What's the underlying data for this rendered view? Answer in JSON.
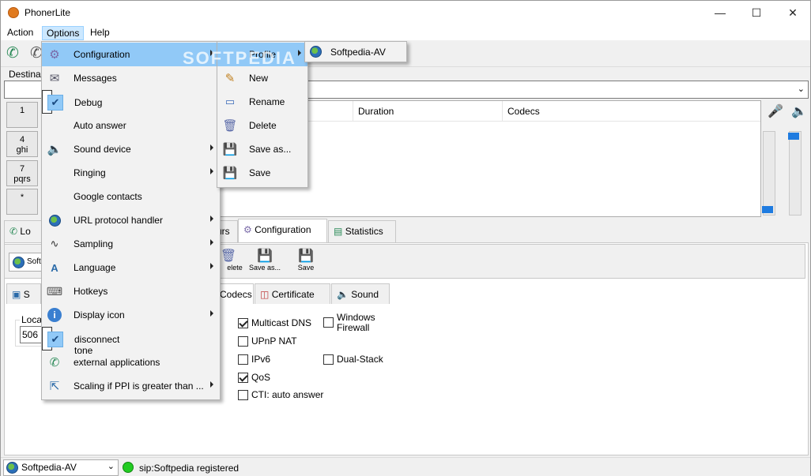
{
  "window": {
    "title": "PhonerLite"
  },
  "menubar": {
    "items": [
      "Action",
      "Options",
      "Help"
    ]
  },
  "destination": {
    "label": "Destina",
    "value": ""
  },
  "keypad": [
    {
      "main": "1",
      "sub": ""
    },
    {
      "main": "4",
      "sub": "ghi"
    },
    {
      "main": "7",
      "sub": "pqrs"
    },
    {
      "main": "*",
      "sub": ""
    }
  ],
  "call_list": {
    "columns": [
      "Duration",
      "Codecs"
    ]
  },
  "tabs_main": {
    "partial_left": "Lo",
    "partial_mid": "urs",
    "configuration": "Configuration",
    "statistics": "Statistics"
  },
  "profile_bar": {
    "profile_partial": "Soft",
    "buttons": [
      "elete",
      "Save as...",
      "Save"
    ]
  },
  "tabs_sub": {
    "partial": "S",
    "codecs": "Codecs",
    "certificate": "Certificate",
    "sound": "Sound"
  },
  "local": {
    "label": "Loca",
    "value": "506"
  },
  "options": [
    {
      "label": "Multicast DNS",
      "checked": true
    },
    {
      "label": "UPnP NAT",
      "checked": false
    },
    {
      "label": "IPv6",
      "checked": false
    },
    {
      "label": "QoS",
      "checked": true
    },
    {
      "label": "CTI: auto answer",
      "checked": false
    },
    {
      "label": "Windows Firewall",
      "checked": false
    },
    {
      "label": "Dual-Stack",
      "checked": false
    }
  ],
  "status": {
    "profile": "Softpedia-AV",
    "text": "sip:Softpedia registered",
    "led_color": "#22cc22"
  },
  "options_menu": [
    {
      "label": "Configuration",
      "icon": "gear-icon",
      "submenu": true,
      "highlight": true
    },
    {
      "label": "Messages",
      "icon": "envelope-icon",
      "submenu": false
    },
    {
      "label": "Debug",
      "icon": "check-icon",
      "submenu": false,
      "checked": true
    },
    {
      "label": "Auto answer",
      "icon": "",
      "submenu": false
    },
    {
      "label": "Sound device",
      "icon": "speaker-icon",
      "submenu": true
    },
    {
      "label": "Ringing",
      "icon": "",
      "submenu": true
    },
    {
      "label": "Google contacts",
      "icon": "",
      "submenu": false
    },
    {
      "label": "URL protocol handler",
      "icon": "globe-icon",
      "submenu": true
    },
    {
      "label": "Sampling",
      "icon": "waveform-icon",
      "submenu": true
    },
    {
      "label": "Language",
      "icon": "language-icon",
      "submenu": true
    },
    {
      "label": "Hotkeys",
      "icon": "keyboard-icon",
      "submenu": false
    },
    {
      "label": "Display icon",
      "icon": "info-icon",
      "submenu": true
    },
    {
      "label": "disconnect tone",
      "icon": "check-icon",
      "submenu": false,
      "checked": true
    },
    {
      "label": "external applications",
      "icon": "phone-icon",
      "submenu": false
    },
    {
      "label": "Scaling if PPI is greater than ...",
      "icon": "scale-icon",
      "submenu": true
    }
  ],
  "config_menu": [
    {
      "label": "Profile",
      "icon": "",
      "submenu": true,
      "highlight": true
    },
    {
      "label": "New",
      "icon": "pencil-icon"
    },
    {
      "label": "Rename",
      "icon": "rename-icon"
    },
    {
      "label": "Delete",
      "icon": "trash-icon"
    },
    {
      "label": "Save as...",
      "icon": "save-as-icon"
    },
    {
      "label": "Save",
      "icon": "save-icon"
    }
  ],
  "profile_menu": [
    {
      "label": "Softpedia-AV",
      "icon": "globe-icon"
    }
  ],
  "watermark": "SOFTPEDIA",
  "colors": {
    "highlight": "#91c9f7",
    "accent": "#2a8a57"
  }
}
